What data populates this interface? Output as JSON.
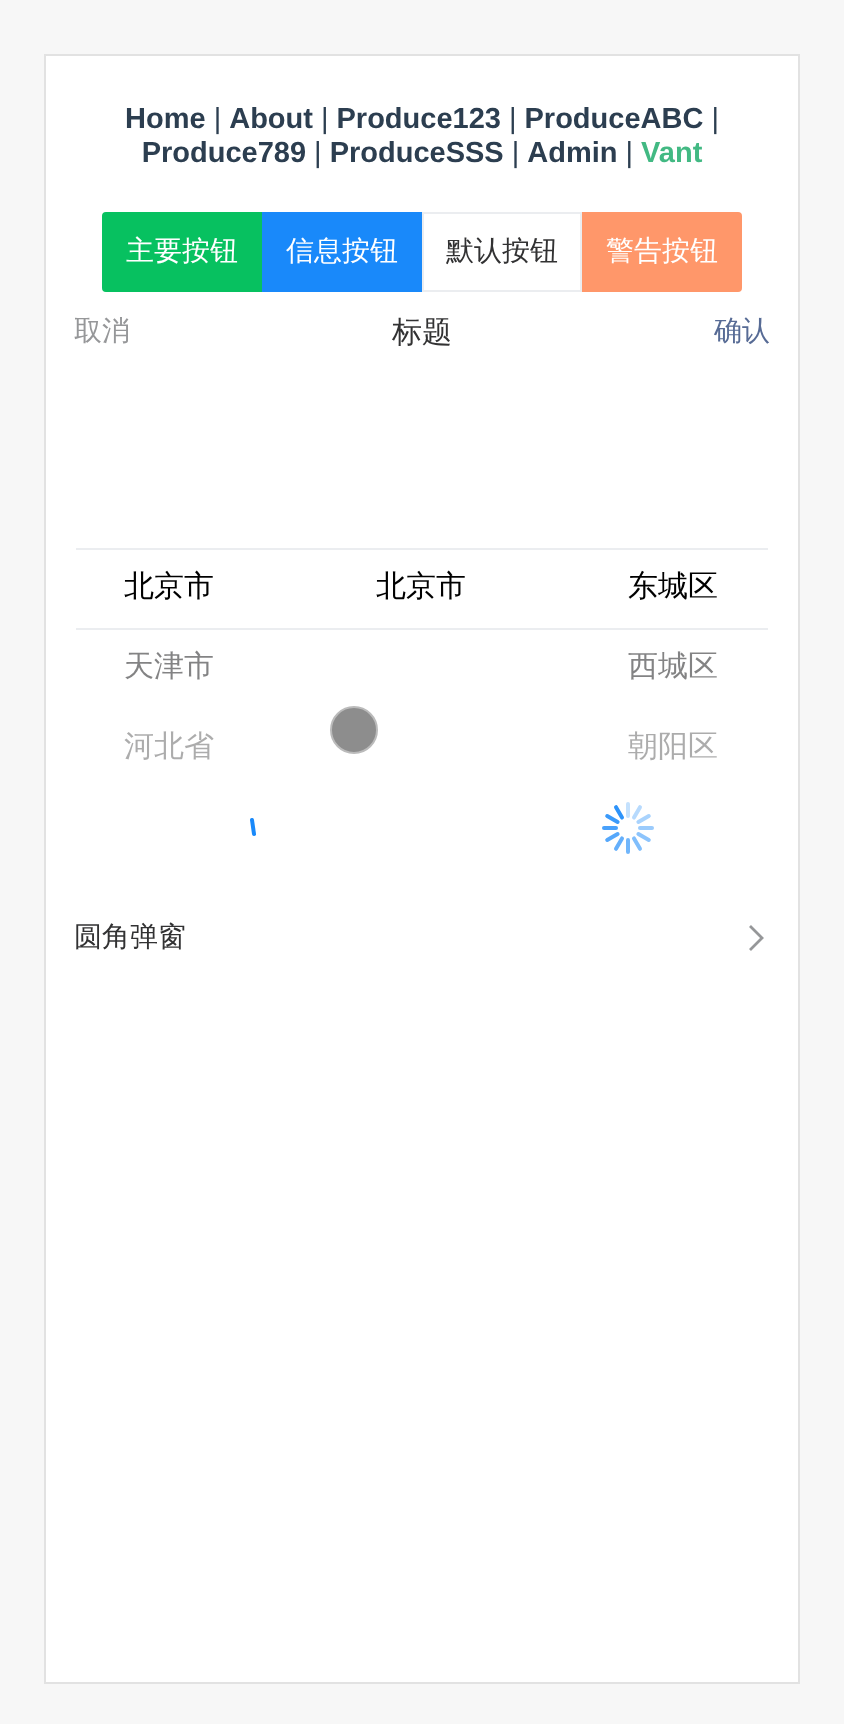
{
  "nav": [
    {
      "label": "Home",
      "active": false
    },
    {
      "label": "About",
      "active": false
    },
    {
      "label": "Produce123",
      "active": false
    },
    {
      "label": "ProduceABC",
      "active": false
    },
    {
      "label": "Produce789",
      "active": false
    },
    {
      "label": "ProduceSSS",
      "active": false
    },
    {
      "label": "Admin",
      "active": false
    },
    {
      "label": "Vant",
      "active": true
    }
  ],
  "separator": "|",
  "buttons": [
    {
      "label": "主要按钮",
      "kind": "primary"
    },
    {
      "label": "信息按钮",
      "kind": "info"
    },
    {
      "label": "默认按钮",
      "kind": "default"
    },
    {
      "label": "警告按钮",
      "kind": "warning"
    }
  ],
  "picker": {
    "cancel": "取消",
    "title": "标题",
    "confirm": "确认",
    "columns": [
      [
        {
          "text": "北京市",
          "selected": true
        },
        {
          "text": "天津市",
          "selected": false
        },
        {
          "text": "河北省",
          "selected": false
        }
      ],
      [
        {
          "text": "北京市",
          "selected": true
        }
      ],
      [
        {
          "text": "东城区",
          "selected": true
        },
        {
          "text": "西城区",
          "selected": false
        },
        {
          "text": "朝阳区",
          "selected": false
        }
      ]
    ]
  },
  "cell": {
    "title": "圆角弹窗"
  }
}
